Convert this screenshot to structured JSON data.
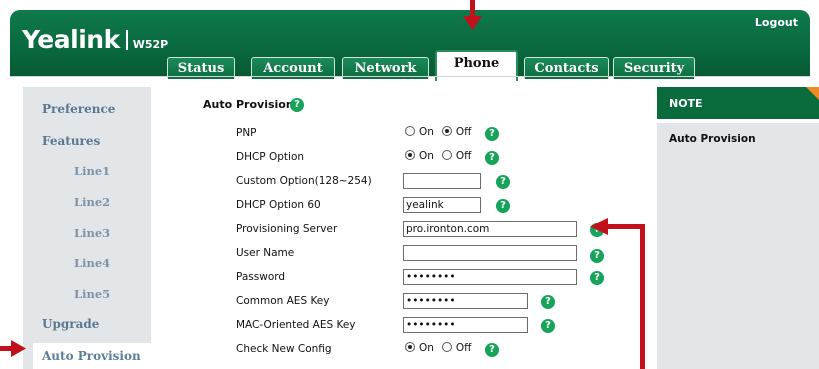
{
  "header": {
    "brand": "Yealink",
    "model": "W52P",
    "logout": "Logout",
    "tabs": [
      {
        "label": "Status"
      },
      {
        "label": "Account"
      },
      {
        "label": "Network"
      },
      {
        "label": "Phone",
        "active": true
      },
      {
        "label": "Contacts"
      },
      {
        "label": "Security"
      }
    ]
  },
  "sidebar": {
    "items": [
      {
        "label": "Preference"
      },
      {
        "label": "Features"
      },
      {
        "label": "Line1"
      },
      {
        "label": "Line2"
      },
      {
        "label": "Line3"
      },
      {
        "label": "Line4"
      },
      {
        "label": "Line5"
      },
      {
        "label": "Upgrade"
      },
      {
        "label": "Auto Provision",
        "active": true
      }
    ]
  },
  "form": {
    "title": "Auto Provision",
    "help_glyph": "?",
    "pnp": {
      "label": "PNP",
      "on": "On",
      "off": "Off",
      "selected": "Off"
    },
    "dhcp_option": {
      "label": "DHCP Option",
      "on": "On",
      "off": "Off",
      "selected": "On"
    },
    "custom_option": {
      "label": "Custom Option(128~254)",
      "value": ""
    },
    "dhcp_option_60": {
      "label": "DHCP Option 60",
      "value": "yealink"
    },
    "provisioning_server": {
      "label": "Provisioning Server",
      "value": "pro.ironton.com"
    },
    "user_name": {
      "label": "User Name",
      "value": ""
    },
    "password": {
      "label": "Password",
      "value": "••••••••"
    },
    "common_aes_key": {
      "label": "Common AES Key",
      "value": "••••••••"
    },
    "mac_aes_key": {
      "label": "MAC-Oriented AES Key",
      "value": "••••••••"
    },
    "check_new_config": {
      "label": "Check New Config",
      "on": "On",
      "off": "Off",
      "selected": "On"
    }
  },
  "note": {
    "heading": "NOTE",
    "text": "Auto Provision"
  },
  "colors": {
    "header_green": "#0a6a3f",
    "help_green": "#16a35a",
    "note_green": "#0a6b3c",
    "note_corner": "#f08a24",
    "annotation_red": "#c0111c",
    "sidebar_bg": "#e3e6e8"
  }
}
